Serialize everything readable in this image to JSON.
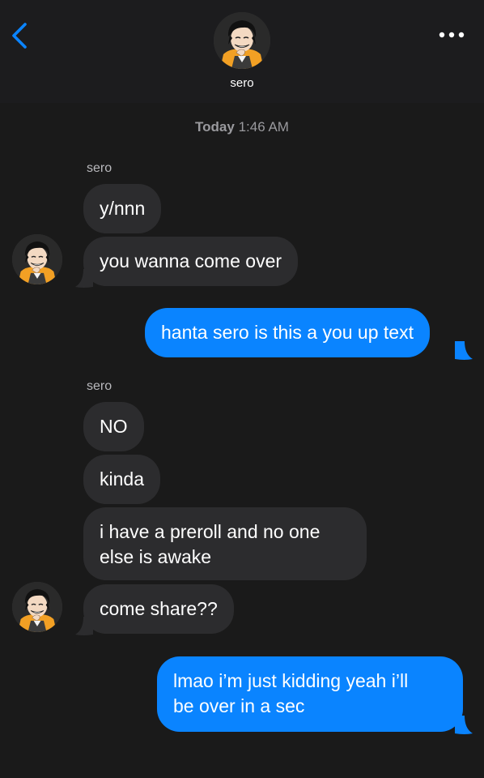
{
  "header": {
    "contact_name": "sero",
    "back_icon": "chevron-left-icon",
    "more_icon": "ellipsis-icon"
  },
  "thread": {
    "timestamp_day": "Today",
    "timestamp_time": "1:46 AM",
    "groups": [
      {
        "sender": "sero",
        "messages": [
          "y/nnn",
          "you wanna come over"
        ]
      },
      {
        "sender": "me",
        "messages": [
          "hanta sero is this a you up text"
        ]
      },
      {
        "sender": "sero",
        "messages": [
          "NO",
          "kinda",
          "i have a preroll and no one\nelse is awake",
          "come share??"
        ]
      },
      {
        "sender": "me",
        "messages": [
          "lmao i’m just kidding yeah i’ll\nbe over in a sec"
        ]
      }
    ]
  },
  "colors": {
    "incoming_bubble": "#2c2c2e",
    "outgoing_bubble": "#0a84ff",
    "background": "#1a1a1a",
    "header": "#1c1c1e",
    "accent": "#0a84ff"
  }
}
